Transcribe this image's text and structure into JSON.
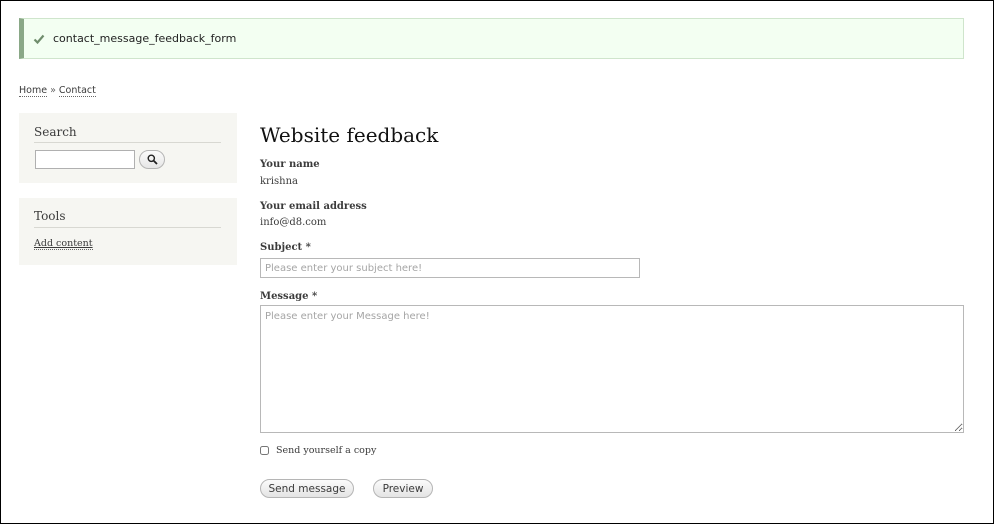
{
  "status": {
    "icon": "checkmark-icon",
    "message": "contact_message_feedback_form"
  },
  "breadcrumb": {
    "home": "Home",
    "separator": "»",
    "current": "Contact"
  },
  "sidebar": {
    "search": {
      "title": "Search",
      "input_value": "",
      "button_icon": "search-icon"
    },
    "tools": {
      "title": "Tools",
      "link": "Add content"
    }
  },
  "main": {
    "title": "Website feedback",
    "name_label": "Your name",
    "name_value": "krishna",
    "email_label": "Your email address",
    "email_value": "info@d8.com",
    "subject_label": "Subject *",
    "subject_placeholder": "Please enter your subject here!",
    "message_label": "Message *",
    "message_placeholder": "Please enter your Message here!",
    "copy_label": "Send yourself a copy",
    "send_button": "Send message",
    "preview_button": "Preview"
  },
  "colors": {
    "status_bg": "#f3fff2",
    "status_border": "#8aa887",
    "sidebar_bg": "#f6f6f2"
  }
}
